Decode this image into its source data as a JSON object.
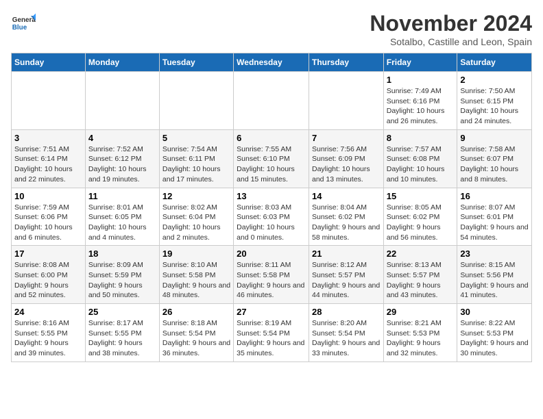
{
  "logo": {
    "general": "General",
    "blue": "Blue"
  },
  "header": {
    "month": "November 2024",
    "location": "Sotalbo, Castille and Leon, Spain"
  },
  "weekdays": [
    "Sunday",
    "Monday",
    "Tuesday",
    "Wednesday",
    "Thursday",
    "Friday",
    "Saturday"
  ],
  "weeks": [
    [
      {
        "day": "",
        "info": ""
      },
      {
        "day": "",
        "info": ""
      },
      {
        "day": "",
        "info": ""
      },
      {
        "day": "",
        "info": ""
      },
      {
        "day": "",
        "info": ""
      },
      {
        "day": "1",
        "info": "Sunrise: 7:49 AM\nSunset: 6:16 PM\nDaylight: 10 hours and 26 minutes."
      },
      {
        "day": "2",
        "info": "Sunrise: 7:50 AM\nSunset: 6:15 PM\nDaylight: 10 hours and 24 minutes."
      }
    ],
    [
      {
        "day": "3",
        "info": "Sunrise: 7:51 AM\nSunset: 6:14 PM\nDaylight: 10 hours and 22 minutes."
      },
      {
        "day": "4",
        "info": "Sunrise: 7:52 AM\nSunset: 6:12 PM\nDaylight: 10 hours and 19 minutes."
      },
      {
        "day": "5",
        "info": "Sunrise: 7:54 AM\nSunset: 6:11 PM\nDaylight: 10 hours and 17 minutes."
      },
      {
        "day": "6",
        "info": "Sunrise: 7:55 AM\nSunset: 6:10 PM\nDaylight: 10 hours and 15 minutes."
      },
      {
        "day": "7",
        "info": "Sunrise: 7:56 AM\nSunset: 6:09 PM\nDaylight: 10 hours and 13 minutes."
      },
      {
        "day": "8",
        "info": "Sunrise: 7:57 AM\nSunset: 6:08 PM\nDaylight: 10 hours and 10 minutes."
      },
      {
        "day": "9",
        "info": "Sunrise: 7:58 AM\nSunset: 6:07 PM\nDaylight: 10 hours and 8 minutes."
      }
    ],
    [
      {
        "day": "10",
        "info": "Sunrise: 7:59 AM\nSunset: 6:06 PM\nDaylight: 10 hours and 6 minutes."
      },
      {
        "day": "11",
        "info": "Sunrise: 8:01 AM\nSunset: 6:05 PM\nDaylight: 10 hours and 4 minutes."
      },
      {
        "day": "12",
        "info": "Sunrise: 8:02 AM\nSunset: 6:04 PM\nDaylight: 10 hours and 2 minutes."
      },
      {
        "day": "13",
        "info": "Sunrise: 8:03 AM\nSunset: 6:03 PM\nDaylight: 10 hours and 0 minutes."
      },
      {
        "day": "14",
        "info": "Sunrise: 8:04 AM\nSunset: 6:02 PM\nDaylight: 9 hours and 58 minutes."
      },
      {
        "day": "15",
        "info": "Sunrise: 8:05 AM\nSunset: 6:02 PM\nDaylight: 9 hours and 56 minutes."
      },
      {
        "day": "16",
        "info": "Sunrise: 8:07 AM\nSunset: 6:01 PM\nDaylight: 9 hours and 54 minutes."
      }
    ],
    [
      {
        "day": "17",
        "info": "Sunrise: 8:08 AM\nSunset: 6:00 PM\nDaylight: 9 hours and 52 minutes."
      },
      {
        "day": "18",
        "info": "Sunrise: 8:09 AM\nSunset: 5:59 PM\nDaylight: 9 hours and 50 minutes."
      },
      {
        "day": "19",
        "info": "Sunrise: 8:10 AM\nSunset: 5:58 PM\nDaylight: 9 hours and 48 minutes."
      },
      {
        "day": "20",
        "info": "Sunrise: 8:11 AM\nSunset: 5:58 PM\nDaylight: 9 hours and 46 minutes."
      },
      {
        "day": "21",
        "info": "Sunrise: 8:12 AM\nSunset: 5:57 PM\nDaylight: 9 hours and 44 minutes."
      },
      {
        "day": "22",
        "info": "Sunrise: 8:13 AM\nSunset: 5:57 PM\nDaylight: 9 hours and 43 minutes."
      },
      {
        "day": "23",
        "info": "Sunrise: 8:15 AM\nSunset: 5:56 PM\nDaylight: 9 hours and 41 minutes."
      }
    ],
    [
      {
        "day": "24",
        "info": "Sunrise: 8:16 AM\nSunset: 5:55 PM\nDaylight: 9 hours and 39 minutes."
      },
      {
        "day": "25",
        "info": "Sunrise: 8:17 AM\nSunset: 5:55 PM\nDaylight: 9 hours and 38 minutes."
      },
      {
        "day": "26",
        "info": "Sunrise: 8:18 AM\nSunset: 5:54 PM\nDaylight: 9 hours and 36 minutes."
      },
      {
        "day": "27",
        "info": "Sunrise: 8:19 AM\nSunset: 5:54 PM\nDaylight: 9 hours and 35 minutes."
      },
      {
        "day": "28",
        "info": "Sunrise: 8:20 AM\nSunset: 5:54 PM\nDaylight: 9 hours and 33 minutes."
      },
      {
        "day": "29",
        "info": "Sunrise: 8:21 AM\nSunset: 5:53 PM\nDaylight: 9 hours and 32 minutes."
      },
      {
        "day": "30",
        "info": "Sunrise: 8:22 AM\nSunset: 5:53 PM\nDaylight: 9 hours and 30 minutes."
      }
    ]
  ]
}
